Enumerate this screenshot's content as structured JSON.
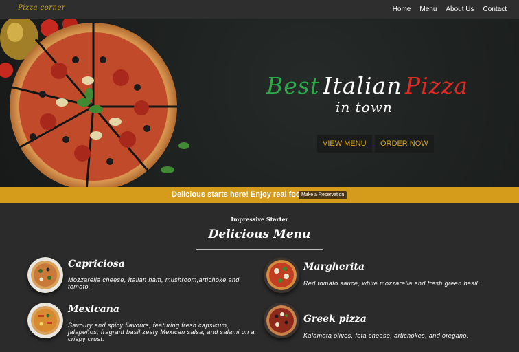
{
  "brand": "Pizza corner",
  "nav": {
    "items": [
      "Home",
      "Menu",
      "About Us",
      "Contact"
    ]
  },
  "hero": {
    "title_words": [
      "Best",
      "Italian",
      "Pizza"
    ],
    "subtitle": "in town",
    "buttons": [
      "VIEW MENU",
      "ORDER NOW"
    ]
  },
  "banner": {
    "text": "Delicious starts here! Enjoy real food!",
    "button": "Make a Reservation"
  },
  "menu": {
    "kicker": "Impressive Starter",
    "title": "Delicious Menu",
    "items": [
      {
        "name": "Capriciosa",
        "description": "Mozzarella cheese, Italian ham, mushroom,artichoke and tomato."
      },
      {
        "name": "Margherita",
        "description": "Red tomato sauce, white mozzarella and fresh green basil.."
      },
      {
        "name": "Mexicana",
        "description": "Savoury and spicy flavours, featuring fresh capsicum, jalapeños, fragrant basil,zesty Mexican salsa, and salami on a crispy crust."
      },
      {
        "name": "Greek pizza",
        "description": "Kalamata olives, feta cheese, artichokes, and oregano."
      }
    ]
  },
  "colors": {
    "accent": "#d49c1a",
    "green": "#2ea84a",
    "red": "#e02a24",
    "background": "#2b2b2b"
  }
}
